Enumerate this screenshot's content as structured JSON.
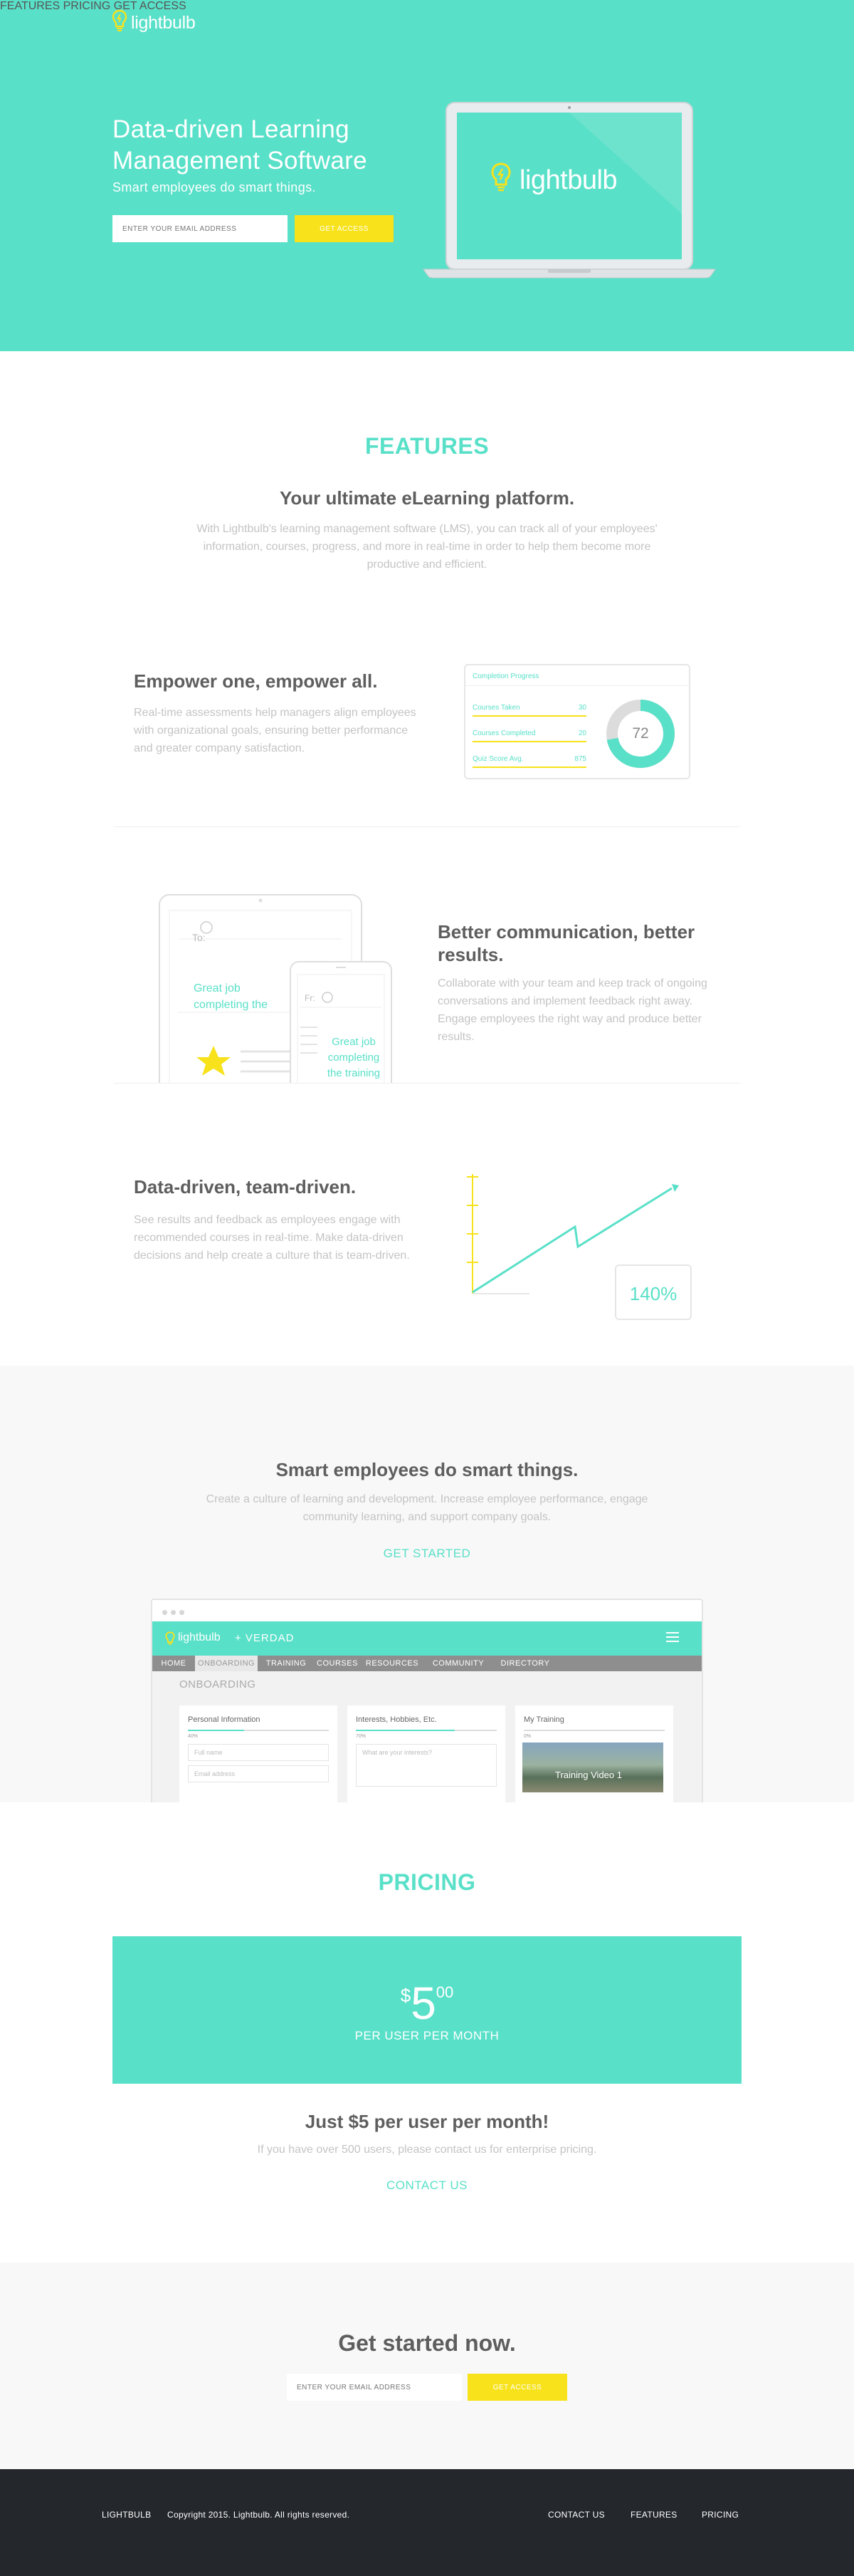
{
  "brand": {
    "name": "lightbulb",
    "accent": "#59e0c8",
    "yellow": "#f7e21b",
    "footer_bg": "#24272c"
  },
  "nav": {
    "features": "FEATURES",
    "pricing": "PRICING",
    "get_access": "GET ACCESS"
  },
  "hero": {
    "title": "Data-driven Learning Management Software",
    "subtitle": "Smart employees do smart things.",
    "email_placeholder": "ENTER YOUR EMAIL ADDRESS",
    "cta": "GET ACCESS",
    "laptop_logo": "lightbulb"
  },
  "features": {
    "heading": "FEATURES",
    "title": "Your ultimate eLearning platform.",
    "text": "With Lightbulb's learning management software (LMS), you can track all of your employees' information, courses, progress, and more in real-time in order to help them become more productive and efficient.",
    "items": [
      {
        "title": "Empower one, empower all.",
        "text": "Real-time assessments help managers align employees with organizational goals, ensuring better performance and greater company satisfaction."
      },
      {
        "title": "Better communication, better results.",
        "text": "Collaborate with your team and keep track of ongoing conversations and implement feedback right away. Engage employees the right way and produce better results."
      },
      {
        "title": "Data-driven, team-driven.",
        "text": "See results and feedback as employees engage with recommended courses in real-time. Make data-driven decisions and help create a culture that is team-driven."
      }
    ],
    "progress_card": {
      "title": "Completion Progress",
      "rows": [
        {
          "label": "Courses Taken",
          "value": "30"
        },
        {
          "label": "Courses Completed",
          "value": "20"
        },
        {
          "label": "Quiz Score Avg.",
          "value": "875"
        }
      ],
      "donut_value": "72",
      "donut_percent": 72
    },
    "message_card": {
      "to_label": "To:",
      "from_label": "Fr:",
      "tablet_message": "Great job completing the training video",
      "phone_message": "Great job completing the training"
    },
    "growth_card": {
      "value": "140%"
    }
  },
  "smart": {
    "title": "Smart employees do smart things.",
    "text": "Create a culture of learning and development. Increase employee performance, engage community learning, and support company goals.",
    "cta": "GET STARTED",
    "app": {
      "brand": "lightbulb",
      "partner": "+ VERDAD",
      "tabs": [
        "HOME",
        "ONBOARDING",
        "TRAINING",
        "COURSES",
        "RESOURCES",
        "COMMUNITY",
        "DIRECTORY"
      ],
      "active_tab": "ONBOARDING",
      "page_title": "ONBOARDING",
      "panels": [
        {
          "title": "Personal Information",
          "percent_label": "40%",
          "progress": 0.4,
          "fields": [
            "Full name",
            "Email address"
          ]
        },
        {
          "title": "Interests, Hobbies, Etc.",
          "percent_label": "70%",
          "progress": 0.7,
          "fields": [
            "What are your interests?"
          ]
        },
        {
          "title": "My Training",
          "percent_label": "0%",
          "progress": 0,
          "fields": [],
          "video_label": "Training Video 1"
        }
      ]
    }
  },
  "pricing": {
    "heading": "PRICING",
    "currency": "$",
    "price": "5",
    "cents": "00",
    "per": "PER USER PER MONTH",
    "title": "Just $5 per user per month!",
    "text": "If you have over 500 users, please contact us for enterprise pricing.",
    "cta": "CONTACT US"
  },
  "get_started": {
    "title": "Get started now.",
    "email_placeholder": "ENTER YOUR EMAIL ADDRESS",
    "cta": "GET ACCESS"
  },
  "footer": {
    "brand": "LIGHTBULB",
    "copyright": "Copyright 2015. Lightbulb. All rights reserved.",
    "links": [
      "CONTACT US",
      "FEATURES",
      "PRICING"
    ]
  }
}
